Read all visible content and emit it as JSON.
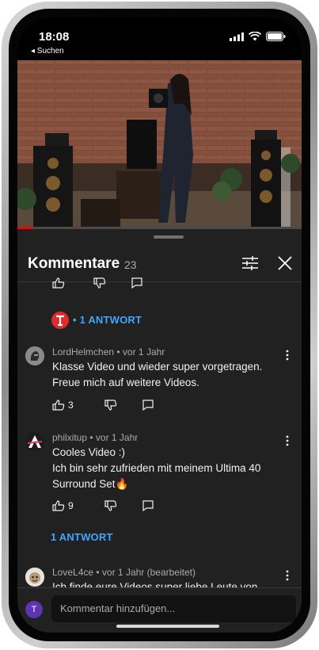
{
  "status_bar": {
    "time": "18:08",
    "back_label": "◂ Suchen"
  },
  "video": {
    "progress_fraction": 0.05
  },
  "panel": {
    "title": "Kommentare",
    "count": "23"
  },
  "collapsed_reply_group": {
    "replies_label": "• 1 ANTWORT"
  },
  "comments": [
    {
      "author": "LordHelmchen",
      "age": "• vor 1 Jahr",
      "lines": [
        "Klasse Video und wieder super vorgetragen.",
        "Freue mich auf weitere Videos."
      ],
      "likes": "3"
    },
    {
      "author": "philxitup",
      "age": "• vor 1 Jahr",
      "lines": [
        "Cooles Video :)",
        "Ich bin sehr zufrieden mit meinem Ultima 40",
        "Surround Set🔥"
      ],
      "likes": "9",
      "replies_label": "1 ANTWORT"
    },
    {
      "author": "LoveL4ce",
      "age": "• vor 1 Jahr (bearbeitet)",
      "lines": [
        "Ich finde eure Videos super liebe Leute von"
      ]
    }
  ],
  "composer": {
    "avatar_letter": "T",
    "placeholder": "Kommentar hinzufügen..."
  },
  "colors": {
    "accent_link": "#3ea6ff",
    "progress": "#ff0000",
    "panel_bg": "#212121"
  }
}
